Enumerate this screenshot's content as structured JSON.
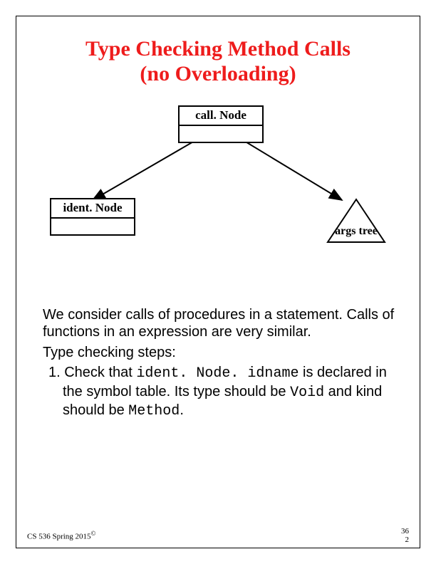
{
  "title_line1": "Type Checking Method Calls",
  "title_line2": "(no Overloading)",
  "diagram": {
    "callNode": "call. Node",
    "identNode": "ident. Node",
    "argsTree": "args tree"
  },
  "body": {
    "para1": "We consider calls of procedures in a statement. Calls of functions in an expression are very similar.",
    "para2": "Type checking steps:",
    "step1_prefix": "1. Check that ",
    "step1_code1": "ident. Node. idname",
    "step1_mid": " is declared in the symbol table. Its type should be ",
    "step1_code2": "Void",
    "step1_mid2": " and kind should be ",
    "step1_code3": "Method",
    "step1_end": "."
  },
  "footer": {
    "course": "CS 536  Spring 2015",
    "copyright": "©",
    "page_top": "36",
    "page_bottom": "2"
  }
}
